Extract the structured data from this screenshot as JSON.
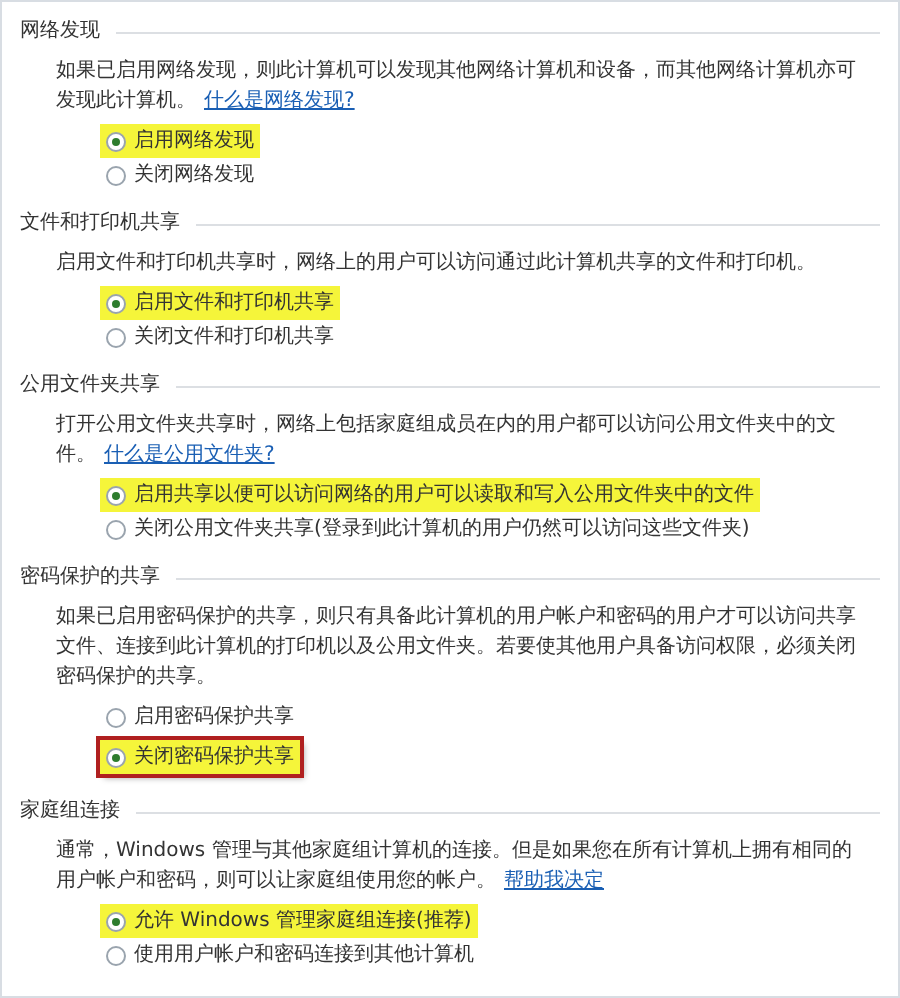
{
  "sections": [
    {
      "title": "网络发现",
      "description": "如果已启用网络发现，则此计算机可以发现其他网络计算机和设备，而其他网络计算机亦可发现此计算机。",
      "link": "什么是网络发现?",
      "options": [
        {
          "label": "启用网络发现",
          "selected": true,
          "highlighted": true,
          "outlined": false
        },
        {
          "label": "关闭网络发现",
          "selected": false,
          "highlighted": false,
          "outlined": false
        }
      ]
    },
    {
      "title": "文件和打印机共享",
      "description": "启用文件和打印机共享时，网络上的用户可以访问通过此计算机共享的文件和打印机。",
      "options": [
        {
          "label": "启用文件和打印机共享",
          "selected": true,
          "highlighted": true,
          "outlined": false
        },
        {
          "label": "关闭文件和打印机共享",
          "selected": false,
          "highlighted": false,
          "outlined": false
        }
      ]
    },
    {
      "title": "公用文件夹共享",
      "description": "打开公用文件夹共享时，网络上包括家庭组成员在内的用户都可以访问公用文件夹中的文件。",
      "link": "什么是公用文件夹?",
      "options": [
        {
          "label": "启用共享以便可以访问网络的用户可以读取和写入公用文件夹中的文件",
          "selected": true,
          "highlighted": true,
          "outlined": false
        },
        {
          "label": "关闭公用文件夹共享(登录到此计算机的用户仍然可以访问这些文件夹)",
          "selected": false,
          "highlighted": false,
          "outlined": false
        }
      ]
    },
    {
      "title": "密码保护的共享",
      "description": "如果已启用密码保护的共享，则只有具备此计算机的用户帐户和密码的用户才可以访问共享文件、连接到此计算机的打印机以及公用文件夹。若要使其他用户具备访问权限，必须关闭密码保护的共享。",
      "options": [
        {
          "label": "启用密码保护共享",
          "selected": false,
          "highlighted": false,
          "outlined": false
        },
        {
          "label": "关闭密码保护共享",
          "selected": true,
          "highlighted": true,
          "outlined": true
        }
      ]
    },
    {
      "title": "家庭组连接",
      "description": "通常，Windows 管理与其他家庭组计算机的连接。但是如果您在所有计算机上拥有相同的用户帐户和密码，则可以让家庭组使用您的帐户。",
      "link": "帮助我决定",
      "options": [
        {
          "label": "允许 Windows 管理家庭组连接(推荐)",
          "selected": true,
          "highlighted": true,
          "outlined": false
        },
        {
          "label": "使用用户帐户和密码连接到其他计算机",
          "selected": false,
          "highlighted": false,
          "outlined": false
        }
      ]
    }
  ]
}
